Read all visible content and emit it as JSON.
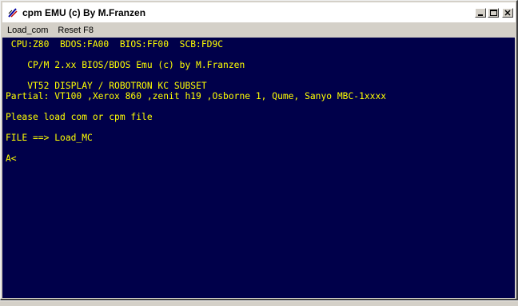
{
  "window": {
    "title": "cpm EMU (c) By M.Franzen",
    "icon": "cpm-app-icon"
  },
  "menu": {
    "items": [
      {
        "label": "Load_com"
      },
      {
        "label": "Reset F8"
      }
    ]
  },
  "terminal": {
    "text_color": "#ffff00",
    "background": "#00004a",
    "lines": [
      " CPU:Z80  BDOS:FA00  BIOS:FF00  SCB:FD9C",
      "    CP/M 2.xx BIOS/BDOS Emu (c) by M.Franzen",
      "    VT52 DISPLAY / ROBOTRON KC SUBSET",
      "Partial: VT100 ,Xerox 860 ,zenit h19 ,Osborne 1, Qume, Sanyo MBC-1xxxx",
      "Please load com or cpm file",
      "FILE ==> Load_MC",
      "A<"
    ]
  }
}
